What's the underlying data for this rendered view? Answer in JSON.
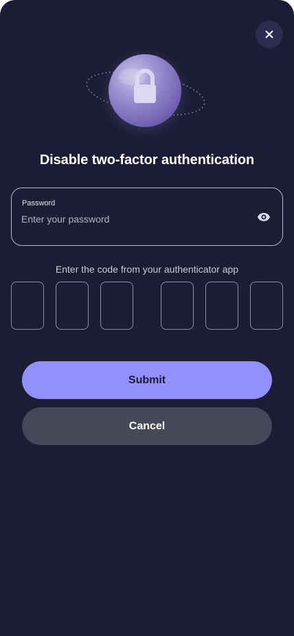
{
  "dialog": {
    "close_icon": "close-icon",
    "hero_icon": "lock-icon",
    "title": "Disable two-factor authentication"
  },
  "password": {
    "label": "Password",
    "value": "",
    "placeholder": "Enter your password",
    "toggle_icon": "eye-icon"
  },
  "code": {
    "label": "Enter the code from your authenticator app",
    "digits": [
      "",
      "",
      "",
      "",
      "",
      ""
    ]
  },
  "actions": {
    "submit_label": "Submit",
    "cancel_label": "Cancel"
  },
  "colors": {
    "background": "#1c1d34",
    "accent": "#9291fb",
    "secondary_button": "#47475a",
    "close_button": "#2c2c4e"
  }
}
